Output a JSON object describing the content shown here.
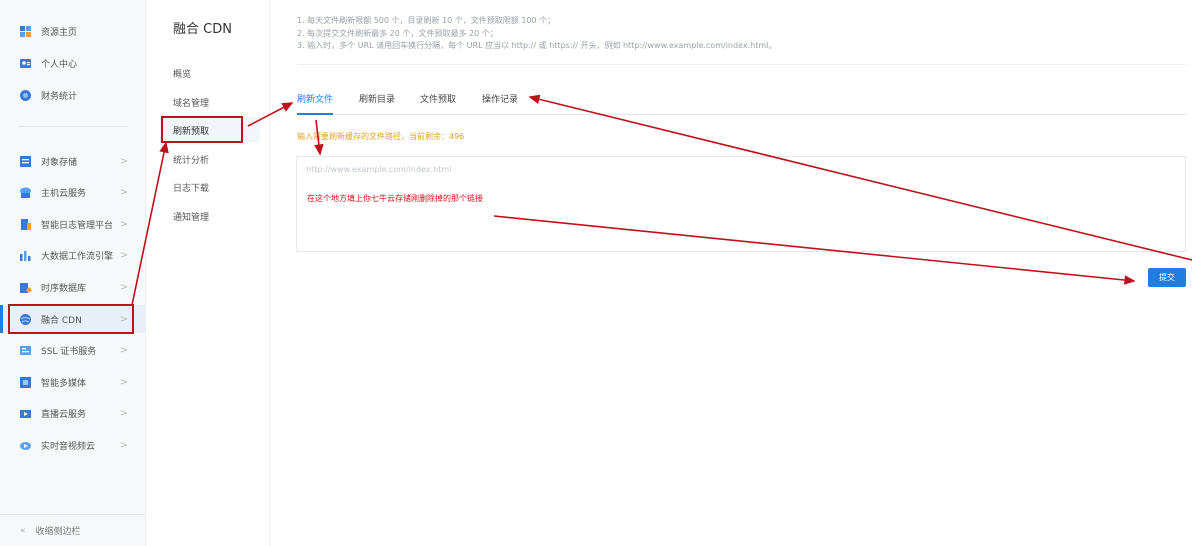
{
  "sidebar": {
    "items": [
      {
        "label": "资源主页",
        "icon": "grid-icon"
      },
      {
        "label": "个人中心",
        "icon": "user-card-icon"
      },
      {
        "label": "财务统计",
        "icon": "coin-icon"
      },
      {
        "label": "对象存储",
        "icon": "storage-icon"
      },
      {
        "label": "主机云服务",
        "icon": "cloud-host-icon"
      },
      {
        "label": "智能日志管理平台",
        "icon": "log-icon"
      },
      {
        "label": "大数据工作流引擎",
        "icon": "workflow-icon"
      },
      {
        "label": "时序数据库",
        "icon": "database-icon"
      },
      {
        "label": "融合 CDN",
        "icon": "globe-icon"
      },
      {
        "label": "SSL 证书服务",
        "icon": "certificate-icon"
      },
      {
        "label": "智能多媒体",
        "icon": "media-icon"
      },
      {
        "label": "直播云服务",
        "icon": "live-icon"
      },
      {
        "label": "实时音视频云",
        "icon": "video-call-icon"
      }
    ],
    "footer": "收缩侧边栏",
    "chevron": ">",
    "collapse_glyph": "«"
  },
  "subnav": {
    "title": "融合 CDN",
    "items": [
      "概览",
      "域名管理",
      "刷新预取",
      "统计分析",
      "日志下载",
      "通知管理"
    ]
  },
  "notes": [
    "1. 每天文件刷新限额 500 个，目录刷新 10 个，文件预取限额 100 个；",
    "2. 每次提交文件刷新最多 20 个，文件预取最多 20 个；",
    "3. 输入时，多个 URL 请用回车换行分隔，每个 URL 应当以 http:// 或 https:// 开头，例如 http://www.example.com/index.html。"
  ],
  "tabs": [
    "刷新文件",
    "刷新目录",
    "文件预取",
    "操作记录"
  ],
  "hint": "输入需要刷新缓存的文件路径，当前剩余：496",
  "textarea": {
    "placeholder": "http://www.example.com/index.html",
    "annotation": "在这个地方填上你七牛云存储刚删除掉的那个链接"
  },
  "submit_label": "提交",
  "colors": {
    "accent": "#1f7fe0",
    "annotation": "#c0101c",
    "hint": "#e3a024"
  }
}
